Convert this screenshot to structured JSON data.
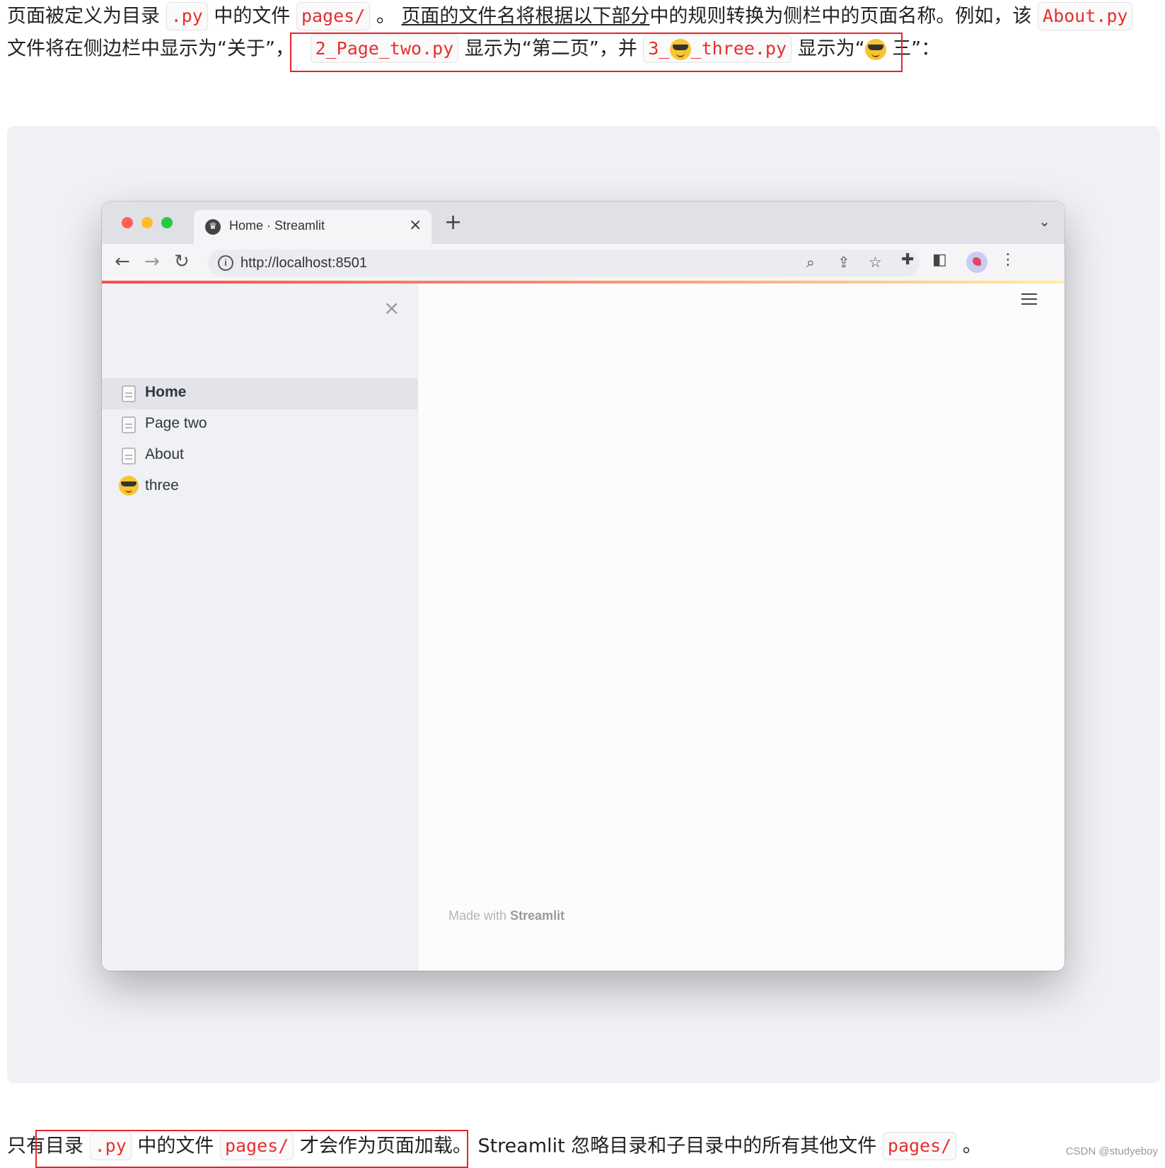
{
  "article": {
    "line1": {
      "t1": "页面被定义为目录",
      "c1": ".py",
      "t2": "中的文件",
      "c2": "pages/",
      "t3": "。",
      "t4": "页面的文件名将根据以下部分",
      "t5": "中的规则转换为侧栏中的页面名称。例如，该",
      "c3": "About.py"
    },
    "line2": {
      "t1": "文件将在侧边栏中显示为“关于”，",
      "c1": "2_Page_two.py",
      "t2": "显示为“第二页”，并",
      "c2a": "3_",
      "c2b": "_three.py",
      "t3": "显示为“",
      "t4": "三”："
    },
    "bottom": {
      "t1": "只有目录",
      "c1": ".py",
      "t2": "中的文件",
      "c2": "pages/",
      "t3": "才会作为页面加载。",
      "t4": "Streamlit 忽略目录和子目录中的所有其他文件",
      "c3": "pages/",
      "t5": "。"
    },
    "credit": "CSDN @studyeboy"
  },
  "browser": {
    "tab_title": "Home · Streamlit",
    "tab_close": "×",
    "new_tab": "+",
    "url": "http://localhost:8501",
    "icons": [
      "back-arrow-icon",
      "forward-arrow-icon",
      "reload-icon",
      "info-icon",
      "zoom-icon",
      "share-icon",
      "star-icon",
      "extensions-icon",
      "sidebar-icon",
      "profile-avatar",
      "menu-dots-icon"
    ],
    "traffic_colors": {
      "close": "#ff5f57",
      "minimize": "#febc2e",
      "maximize": "#28c840"
    }
  },
  "app": {
    "sidebar_close": "×",
    "nav": [
      {
        "label": "Home",
        "icon": "page-icon",
        "active": true
      },
      {
        "label": "Page two",
        "icon": "page-icon",
        "active": false
      },
      {
        "label": "About",
        "icon": "page-icon",
        "active": false
      },
      {
        "label": "three",
        "icon": "sunglasses-emoji",
        "active": false
      }
    ],
    "footer_prefix": "Made with",
    "footer_brand": "Streamlit",
    "accent": "#ff4b4b"
  }
}
